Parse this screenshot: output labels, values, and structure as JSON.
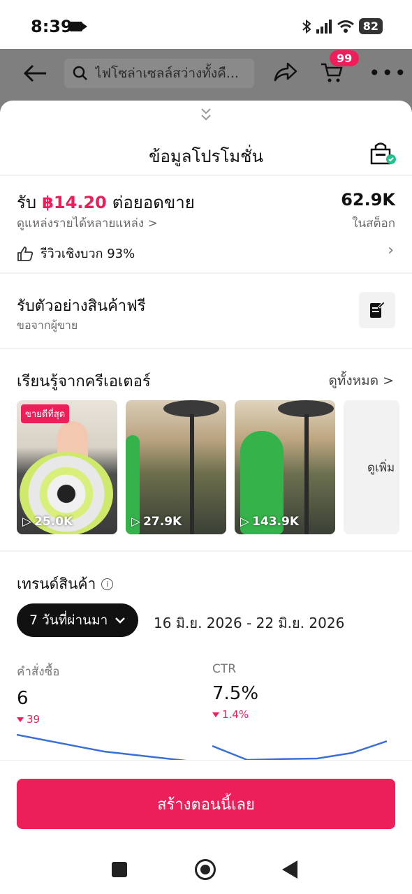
{
  "status": {
    "time": "8:39",
    "battery": "82"
  },
  "header": {
    "search_placeholder": "ไฟโซล่าเซลล์สว่างทั้งคื...",
    "cart_count": "99"
  },
  "sheet": {
    "title": "ข้อมูลโปรโมชั่น",
    "earn": {
      "prefix": "รับ",
      "amount": "฿14.20",
      "suffix": "ต่อยอดขาย",
      "income_link": "ดูแหล่งรายได้หลายแหล่ง >",
      "stock_value": "62.9K",
      "stock_label": "ในสต็อก",
      "review": "รีวิวเชิงบวก 93%"
    },
    "sample": {
      "title": "รับตัวอย่างสินค้าฟรี",
      "subtitle": "ขอจากผู้ขาย"
    },
    "learn": {
      "title": "เรียนรู้จากครีเอเตอร์",
      "see_all": "ดูทั้งหมด >",
      "videos": [
        {
          "views": "25.0K",
          "badge": "ขายดีที่สุด"
        },
        {
          "views": "27.9K"
        },
        {
          "views": "143.9K"
        }
      ],
      "see_more": "ดูเพิ่ม"
    },
    "trend": {
      "title": "เทรนด์สินค้า",
      "period": "7 วันที่ผ่านมา",
      "date_range": "16 มิ.ย. 2026 - 22 มิ.ย. 2026",
      "metrics": [
        {
          "label": "คำสั่งซื้อ",
          "value": "6",
          "delta": "39",
          "trend": [
            0.95,
            0.35,
            0.0
          ]
        },
        {
          "label": "CTR",
          "value": "7.5%",
          "delta": "1.4%",
          "trend": [
            0.55,
            0.05,
            0.08,
            0.1,
            0.3,
            0.72
          ]
        }
      ]
    },
    "cta": "สร้างตอนนี้เลย"
  },
  "colors": {
    "accent": "#ed1f5b",
    "chart_line": "#3b6fd8"
  }
}
